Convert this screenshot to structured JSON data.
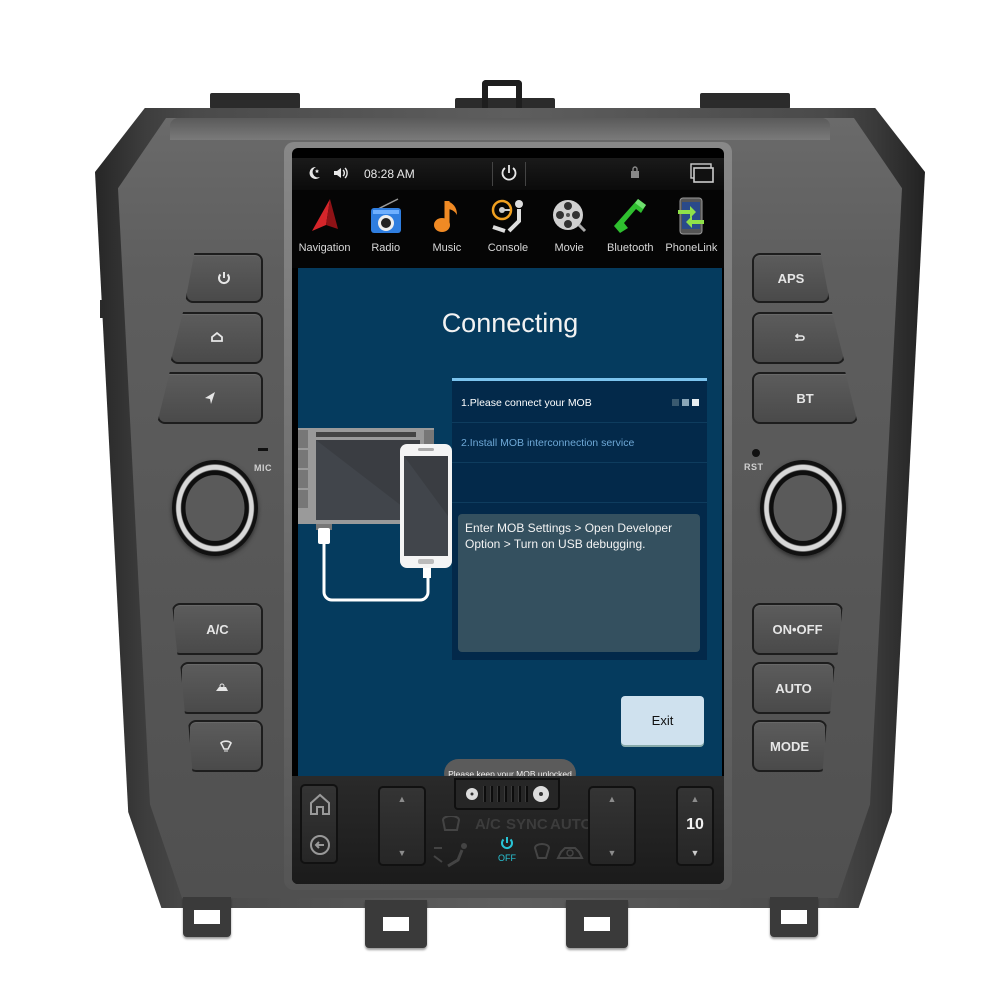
{
  "hardware": {
    "left_top_buttons": [
      {
        "name": "power",
        "icon": "power-icon"
      },
      {
        "name": "home",
        "icon": "home-icon"
      },
      {
        "name": "navigation",
        "icon": "navigation-arrow-icon"
      }
    ],
    "right_top_buttons": [
      {
        "name": "aps",
        "label": "APS"
      },
      {
        "name": "back",
        "icon": "back-arrow-icon"
      },
      {
        "name": "bt",
        "label": "BT"
      }
    ],
    "left_bottom_buttons": [
      {
        "name": "ac",
        "label": "A/C"
      },
      {
        "name": "recirculation",
        "icon": "car-recirculation-icon"
      },
      {
        "name": "defrost",
        "icon": "defrost-icon"
      }
    ],
    "right_bottom_buttons": [
      {
        "name": "on-off",
        "label": "ON•OFF"
      },
      {
        "name": "auto",
        "label": "AUTO"
      },
      {
        "name": "mode",
        "label": "MODE"
      }
    ],
    "mic_label": "MIC",
    "rst_label": "RST"
  },
  "status_bar": {
    "time": "08:28 AM",
    "icons": [
      "night-mode-icon",
      "volume-icon",
      "power-icon",
      "lock-icon",
      "window-switch-icon"
    ]
  },
  "dock": {
    "apps": [
      {
        "label": "Navigation",
        "icon": "navigation-icon"
      },
      {
        "label": "Radio",
        "icon": "radio-icon"
      },
      {
        "label": "Music",
        "icon": "music-icon"
      },
      {
        "label": "Console",
        "icon": "console-icon"
      },
      {
        "label": "Movie",
        "icon": "movie-reel-icon"
      },
      {
        "label": "Bluetooth",
        "icon": "bluetooth-phone-icon"
      },
      {
        "label": "PhoneLink",
        "icon": "phonelink-icon"
      }
    ]
  },
  "main": {
    "title": "Connecting",
    "steps": [
      {
        "label": "1.Please connect your MOB",
        "state": "active"
      },
      {
        "label": "2.Install MOB interconnection service",
        "state": "pending"
      }
    ],
    "progress": {
      "total": 3,
      "current": 3
    },
    "hint": "Enter MOB Settings > Open Developer Option > Turn on USB debugging.",
    "exit_label": "Exit",
    "toast": "Please keep your MOB unlocked"
  },
  "climate": {
    "labels": {
      "ac": "A/C",
      "sync": "SYNC",
      "auto": "AUTO"
    },
    "power_label": "OFF",
    "fan_speed_levels": 7,
    "temperature_right": "10",
    "accent_color": "#29c4d6"
  },
  "colors": {
    "screen_bg": "#053b5e",
    "panel_bg": "#03294a",
    "accent": "#7cc4ee",
    "hint_bg": "#34505f",
    "exit_bg": "#cfe1ee"
  }
}
